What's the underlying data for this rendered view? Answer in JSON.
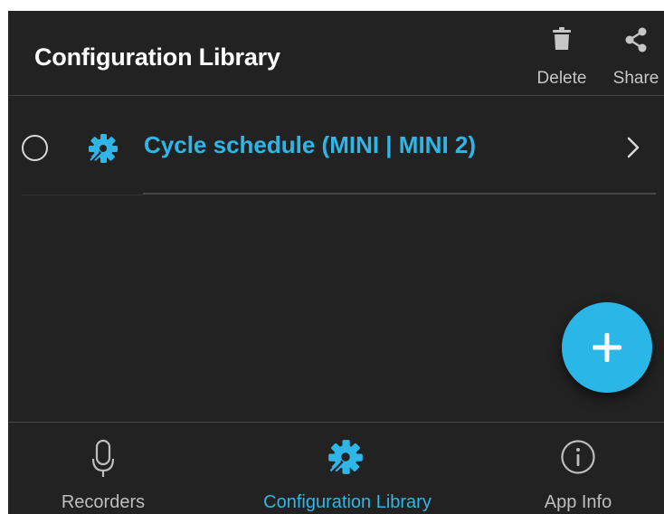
{
  "header": {
    "title": "Configuration Library",
    "actions": [
      {
        "label": "Delete",
        "icon": "trash-icon"
      },
      {
        "label": "Share",
        "icon": "share-icon"
      }
    ]
  },
  "list": {
    "items": [
      {
        "label": "Cycle schedule (MINI | MINI 2)",
        "icon": "gear-wrench-icon",
        "selected": false
      }
    ]
  },
  "fab": {
    "icon": "plus-icon"
  },
  "bottom_nav": {
    "items": [
      {
        "label": "Recorders",
        "icon": "microphone-icon",
        "active": false
      },
      {
        "label": "Configuration Library",
        "icon": "gear-wrench-icon",
        "active": true
      },
      {
        "label": "App Info",
        "icon": "info-icon",
        "active": false
      }
    ]
  },
  "colors": {
    "background": "#222222",
    "accent": "#2fb6e6",
    "text_primary": "#ffffff",
    "text_secondary": "#c6c6c6"
  }
}
